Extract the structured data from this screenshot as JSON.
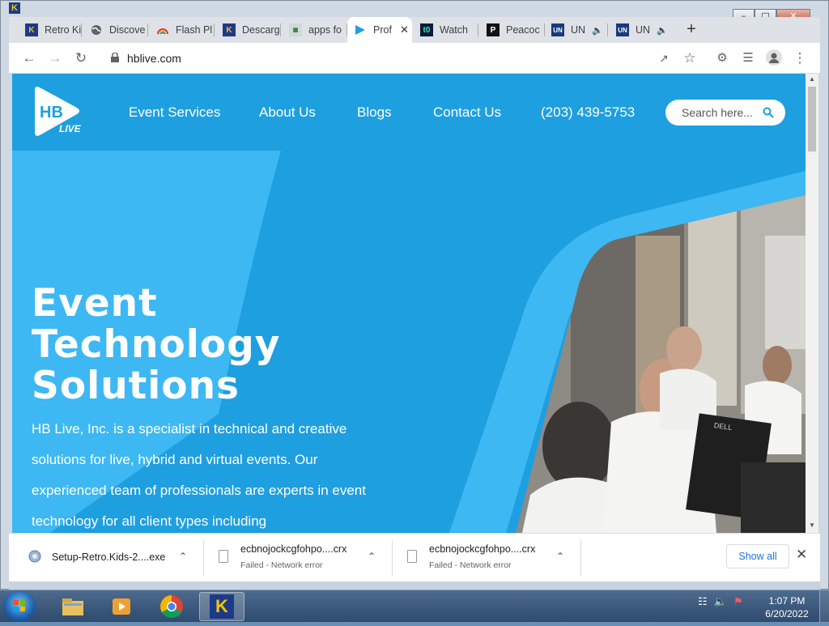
{
  "titlebar": {
    "app_icon": "K"
  },
  "tabs": [
    {
      "title": "Retro Ki",
      "favicon": "retro-kids-icon"
    },
    {
      "title": "Discove",
      "favicon": "globe-icon"
    },
    {
      "title": "Flash Pl",
      "favicon": "rainbow-icon"
    },
    {
      "title": "Descarg",
      "favicon": "retro-kids-icon"
    },
    {
      "title": "apps fo",
      "favicon": "apps-icon"
    },
    {
      "title": "Prof",
      "favicon": "hb-live-icon",
      "active": true
    },
    {
      "title": "Watch",
      "favicon": "watch-icon"
    },
    {
      "title": "Peacoc",
      "favicon": "peacock-icon"
    },
    {
      "title": "UN",
      "favicon": "un-icon",
      "audio": true
    },
    {
      "title": "UN",
      "favicon": "un-icon",
      "audio": true
    }
  ],
  "toolbar": {
    "url": "hblive.com"
  },
  "site": {
    "logo_text": "HB",
    "logo_subtext": "LIVE",
    "nav": [
      "Event Services",
      "About Us",
      "Blogs",
      "Contact Us",
      "(203) 439-5753"
    ],
    "search_placeholder": "Search here...",
    "hero_title_lines": [
      "Event",
      "Technology",
      "Solutions"
    ],
    "hero_body": "HB Live, Inc. is a specialist in technical and creative solutions for live, hybrid and virtual events. Our experienced team of professionals are experts in event technology for all client types including",
    "hero_image_monitor": "DELL"
  },
  "downloads": [
    {
      "name": "Setup-Retro.Kids-2....exe",
      "status": ""
    },
    {
      "name": "ecbnojockcgfohpo....crx",
      "status": "Failed - Network error"
    },
    {
      "name": "ecbnojockcgfohpo....crx",
      "status": "Failed - Network error"
    }
  ],
  "downloads_bar": {
    "show_all": "Show all"
  },
  "taskbar": {
    "time": "1:07 PM",
    "date": "6/20/2022",
    "active_app": "K"
  },
  "colors": {
    "site_blue": "#1e9fe0",
    "site_light_blue": "#3db8f2",
    "chrome_tab_bg": "#dee1e6"
  }
}
